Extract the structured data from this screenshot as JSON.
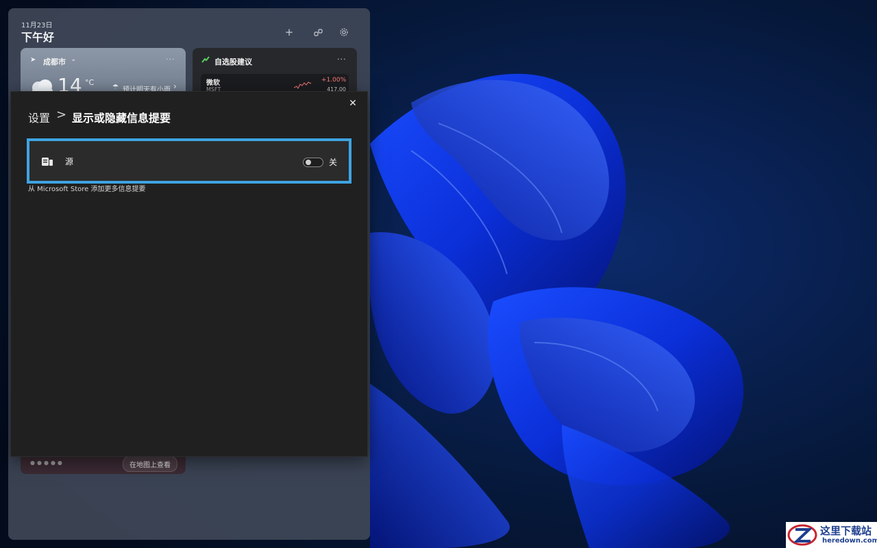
{
  "board": {
    "date": "11月23日",
    "greeting": "下午好"
  },
  "weather": {
    "city": "成都市",
    "temp": "14",
    "unit": "°C",
    "forecast": "预计明天有小雨"
  },
  "stocks": {
    "title": "自选股建议",
    "name": "微软",
    "ticker": "MSFT",
    "change": "+1.00%",
    "price": "417.00",
    "change_color": "#ff7a7a"
  },
  "map": {
    "button": "在地图上查看"
  },
  "settings": {
    "crumb_root": "设置",
    "crumb_separator": ">",
    "crumb_current": "显示或隐藏信息提要",
    "feed_label": "源",
    "toggle_state": "关",
    "toggle_on": false,
    "store_link": "从 Microsoft Store 添加更多信息提要",
    "accent_color": "#3ea4e1"
  },
  "watermark": {
    "cn": "这里下载站",
    "en": "heredown.com"
  }
}
